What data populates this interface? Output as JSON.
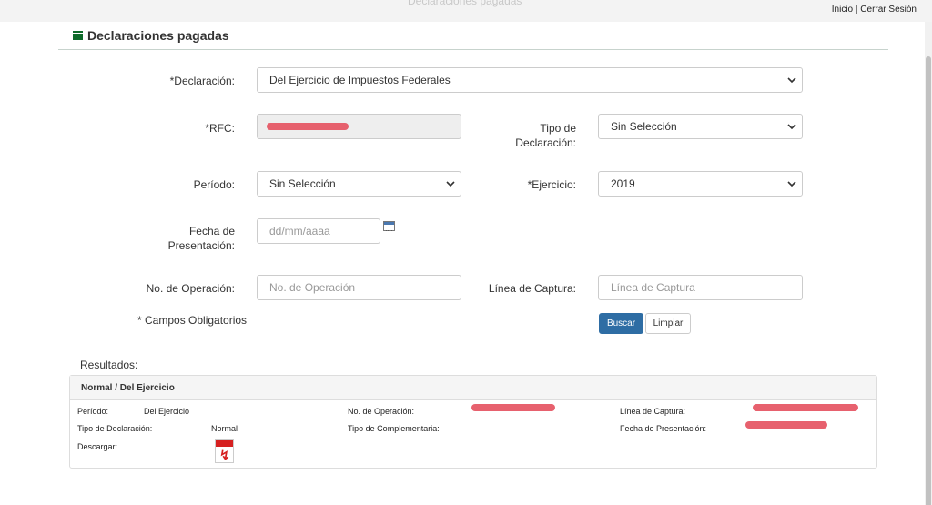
{
  "window": {
    "faded_title": "Declaraciones pagadas"
  },
  "toplinks": {
    "inicio": "Inicio",
    "sep": "|",
    "cerrar": "Cerrar Sesión"
  },
  "section": {
    "title": "Declaraciones pagadas",
    "icon": "archive-box-icon"
  },
  "form": {
    "declaracion": {
      "label": "*Declaración:",
      "value": "Del Ejercicio de Impuestos Federales"
    },
    "rfc": {
      "label": "*RFC:"
    },
    "tipo_declaracion": {
      "label_line1": "Tipo de",
      "label_line2": "Declaración:",
      "value": "Sin Selección"
    },
    "periodo": {
      "label": "Período:",
      "value": "Sin Selección"
    },
    "ejercicio": {
      "label": "*Ejercicio:",
      "value": "2019"
    },
    "fecha": {
      "label_line1": "Fecha de",
      "label_line2": "Presentación:",
      "placeholder": "dd/mm/aaaa"
    },
    "no_operacion": {
      "label": "No. de Operación:",
      "placeholder": "No. de Operación"
    },
    "linea_captura": {
      "label": "Línea de Captura:",
      "placeholder": "Línea de Captura"
    },
    "obligatorios": "* Campos Obligatorios",
    "buscar": "Buscar",
    "limpiar": "Limpiar"
  },
  "results": {
    "label": "Resultados:",
    "panel_title": "Normal / Del Ejercicio",
    "periodo_label": "Período:",
    "periodo_value": "Del Ejercicio",
    "no_operacion_label": "No. de Operación:",
    "linea_captura_label": "Línea de Captura:",
    "tipo_declaracion_label": "Tipo de Declaración:",
    "tipo_declaracion_value": "Normal",
    "tipo_complementaria_label": "Tipo de Complementaria:",
    "fecha_presentacion_label": "Fecha de Presentación:",
    "descargar_label": "Descargar:"
  },
  "colors": {
    "primary": "#2e6da4",
    "section_icon": "#0e6b2a",
    "redaction": "#e4505e"
  }
}
